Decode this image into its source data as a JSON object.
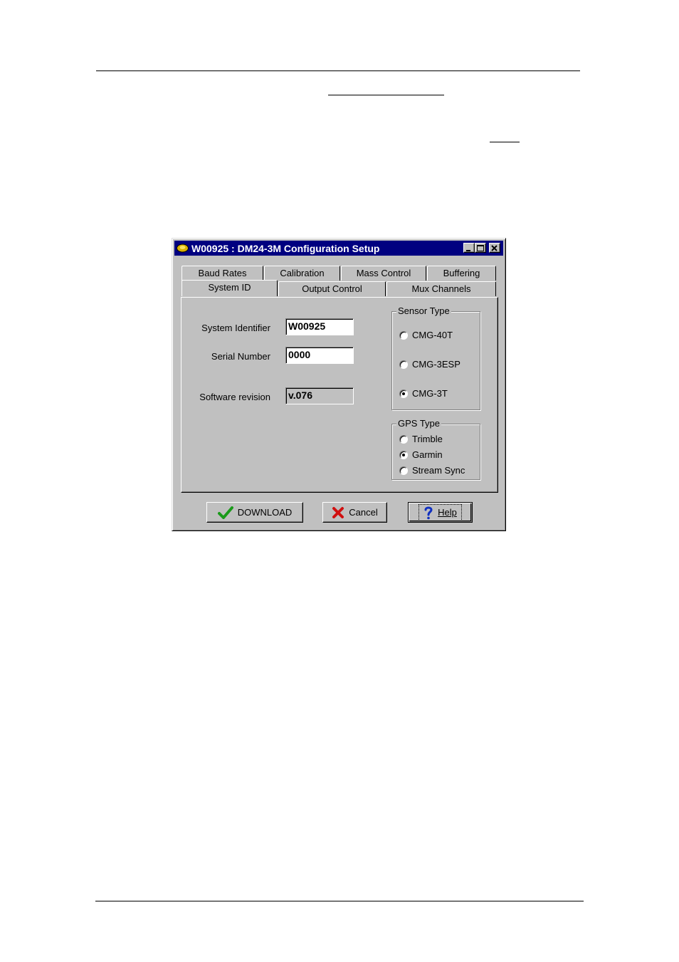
{
  "window": {
    "title": "W00925 : DM24-3M Configuration Setup"
  },
  "tabs": {
    "row_back": [
      "Baud Rates",
      "Calibration",
      "Mass Control",
      "Buffering"
    ],
    "row_front": [
      "System ID",
      "Output Control",
      "Mux Channels"
    ],
    "active": "System ID"
  },
  "system_id": {
    "system_identifier_label": "System Identifier",
    "system_identifier_value": "W00925",
    "serial_number_label": "Serial Number",
    "serial_number_value": "0000",
    "software_revision_label": "Software revision",
    "software_revision_value": "v.076"
  },
  "sensor_type": {
    "title": "Sensor Type",
    "options": [
      "CMG-40T",
      "CMG-3ESP",
      "CMG-3T"
    ],
    "selected": "CMG-3T"
  },
  "gps_type": {
    "title": "GPS Type",
    "options": [
      "Trimble",
      "Garmin",
      "Stream Sync"
    ],
    "selected": "Garmin"
  },
  "buttons": {
    "download": "DOWNLOAD",
    "cancel": "Cancel",
    "help": "Help"
  },
  "colors": {
    "titlebar": "#000080",
    "face": "#c0c0c0",
    "check_green": "#1a9a1a",
    "cancel_red": "#d01010",
    "help_blue": "#1030c0"
  }
}
